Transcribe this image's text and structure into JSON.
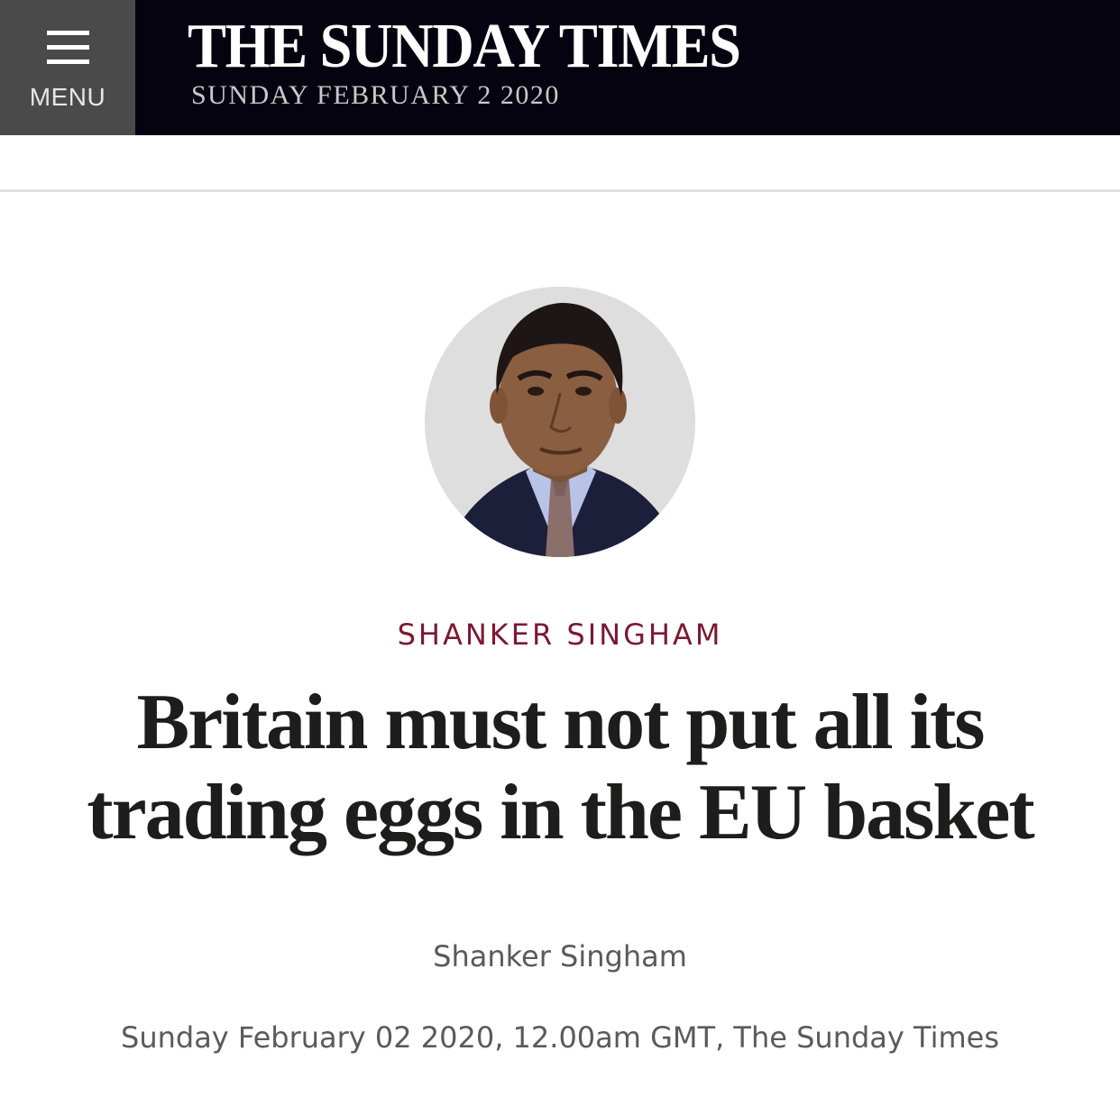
{
  "header": {
    "menu_label": "MENU",
    "brand_title": "THE SUNDAY TIMES",
    "edition_date": "SUNDAY FEBRUARY 2 2020",
    "background_color": "#05030f",
    "menu_background_color": "#4a4a4a"
  },
  "article": {
    "author_kicker": "SHANKER SINGHAM",
    "headline": "Britain must not put all its trading eggs in the EU basket",
    "byline": "Shanker Singham",
    "dateline": "Sunday February 02 2020, 12.00am GMT, The Sunday Times",
    "kicker_color": "#7b1932"
  },
  "icons": {
    "menu": "hamburger-menu-icon"
  }
}
